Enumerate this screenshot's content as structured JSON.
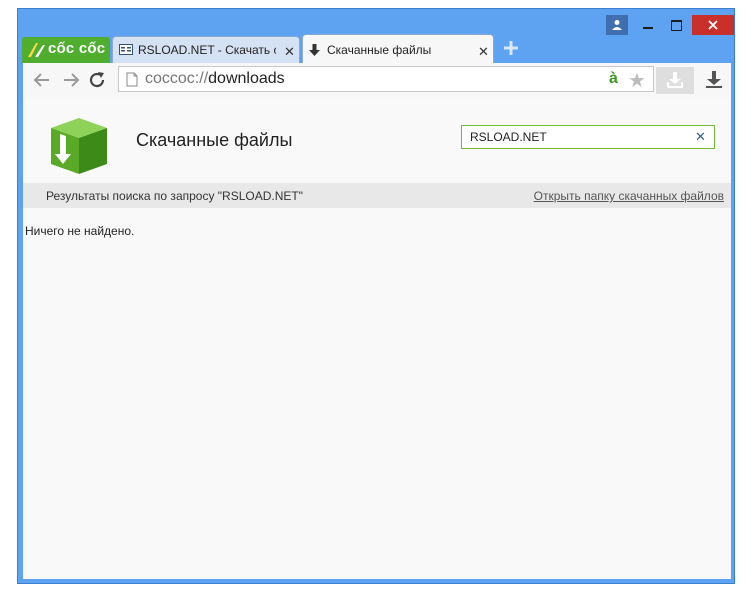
{
  "browser": {
    "logo_text": "cốc cốc",
    "tabs": [
      {
        "title": "RSLOAD.NET - Скачать со",
        "active": false,
        "favicon": "rsload-favicon"
      },
      {
        "title": "Скачанные файлы",
        "active": true,
        "favicon": "download-arrow-icon"
      }
    ],
    "address": {
      "scheme": "coccoc://",
      "host": "downloads"
    },
    "ext_letter": "à"
  },
  "downloads": {
    "title": "Скачанные файлы",
    "search_value": "RSLOAD.NET",
    "results_label": "Результаты поиска по запросу \"RSLOAD.NET\"",
    "open_folder_link": "Открыть папку скачанных файлов",
    "empty_message": "Ничего не найдено."
  },
  "colors": {
    "accent_green": "#4fae2e",
    "window_frame": "#5ea2f2",
    "close_red": "#c9302c"
  }
}
